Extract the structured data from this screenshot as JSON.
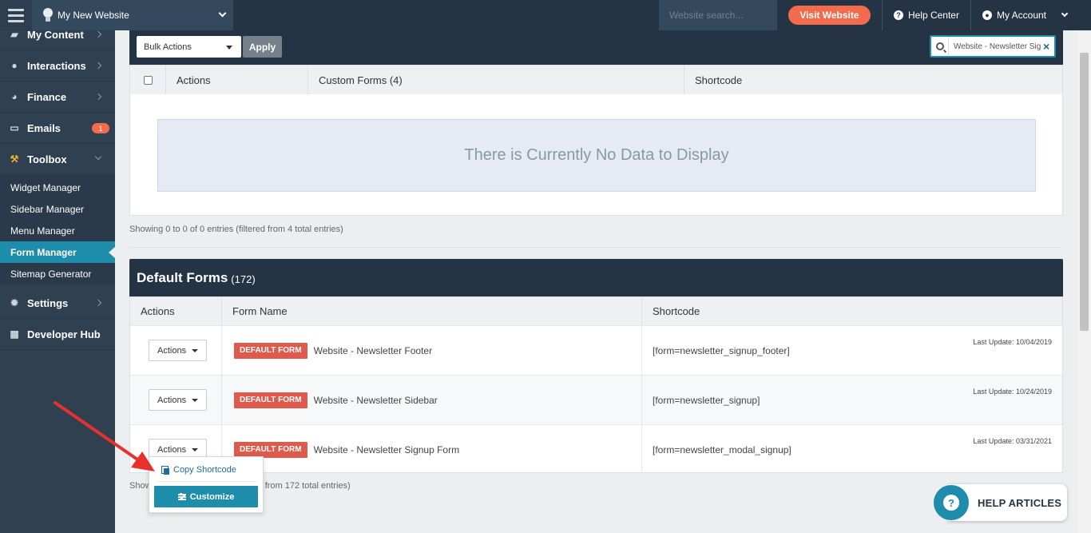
{
  "topbar": {
    "site_name": "My New Website",
    "search_placeholder": "Website search...",
    "visit_label": "Visit Website",
    "help_label": "Help Center",
    "account_label": "My Account"
  },
  "sidebar": {
    "items": [
      {
        "label": "My Content",
        "icon": "folder-icon"
      },
      {
        "label": "Interactions",
        "icon": "chat-icon"
      },
      {
        "label": "Finance",
        "icon": "pie-chart-icon"
      },
      {
        "label": "Emails",
        "icon": "inbox-icon",
        "badge": "1"
      },
      {
        "label": "Toolbox",
        "icon": "wrench-icon"
      }
    ],
    "sub_items": [
      {
        "label": "Widget Manager"
      },
      {
        "label": "Sidebar Manager"
      },
      {
        "label": "Menu Manager"
      },
      {
        "label": "Form Manager",
        "active": true
      },
      {
        "label": "Sitemap Generator"
      }
    ],
    "bottom_items": [
      {
        "label": "Settings",
        "icon": "gear-icon"
      },
      {
        "label": "Developer Hub",
        "icon": "grid-icon"
      }
    ]
  },
  "custom_forms": {
    "bulk_label": "Bulk Actions",
    "apply_label": "Apply",
    "filter_value": "Website - Newsletter Signup",
    "columns": [
      "Actions",
      "Custom Forms (4)",
      "Shortcode"
    ],
    "empty_message": "There is Currently No Data to Display",
    "showing": "Showing 0 to 0 of 0 entries (filtered from 4 total entries)"
  },
  "default_forms": {
    "title": "Default Forms",
    "count": "(172)",
    "columns": [
      "Actions",
      "Form Name",
      "Shortcode"
    ],
    "rows": [
      {
        "actions_label": "Actions",
        "badge": "DEFAULT FORM",
        "name": "Website - Newsletter Footer",
        "shortcode": "[form=newsletter_signup_footer]",
        "last_update": "Last Update: 10/04/2019"
      },
      {
        "actions_label": "Actions",
        "badge": "DEFAULT FORM",
        "name": "Website - Newsletter Sidebar",
        "shortcode": "[form=newsletter_signup]",
        "last_update": "Last Update: 10/24/2019"
      },
      {
        "actions_label": "Actions",
        "badge": "DEFAULT FORM",
        "name": "Website - Newsletter Signup Form",
        "shortcode": "[form=newsletter_modal_signup]",
        "last_update": "Last Update: 03/31/2021"
      }
    ],
    "showing_left": "Show",
    "showing_right": "d from 172 total entries)"
  },
  "dropdown": {
    "copy_label": "Copy Shortcode",
    "customize_label": "Customize"
  },
  "help": {
    "label": "HELP ARTICLES"
  },
  "colors": {
    "navy": "#253444",
    "accent": "#1e8cab",
    "orange": "#f26b4c",
    "badge_red": "#e05a4b",
    "annotation_arrow": "#e8312d"
  }
}
